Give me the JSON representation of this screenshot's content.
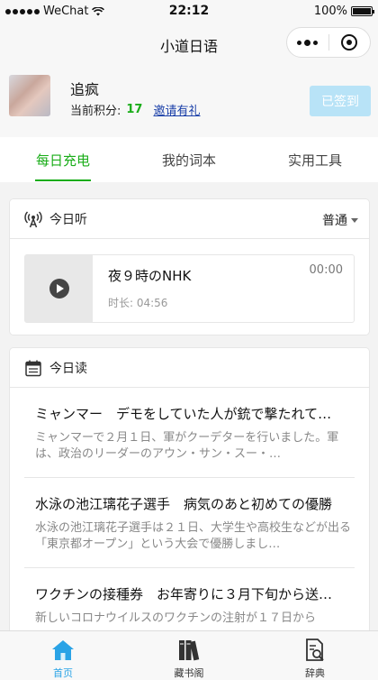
{
  "status_bar": {
    "carrier": "WeChat",
    "time": "22:12",
    "battery": "100%"
  },
  "nav": {
    "title": "小道日语"
  },
  "profile": {
    "username": "追疯",
    "points_label": "当前积分:",
    "points_value": "17",
    "invite_label": "邀请有礼",
    "signin_label": "已签到"
  },
  "tabs": [
    {
      "label": "每日充电",
      "active": true
    },
    {
      "label": "我的词本",
      "active": false
    },
    {
      "label": "实用工具",
      "active": false
    }
  ],
  "listen": {
    "title": "今日听",
    "level": "普通",
    "item": {
      "title": "夜９時のNHK",
      "duration": "时长: 04:56",
      "current_time": "00:00"
    }
  },
  "read": {
    "title": "今日读",
    "articles": [
      {
        "title": "ミャンマー　デモをしていた人が銃で撃たれて…",
        "body": "ミャンマーで２月１日、軍がクーデターを行いました。軍は、政治のリーダーのアウン・サン・スー・…"
      },
      {
        "title": "水泳の池江璃花子選手　病気のあと初めての優勝",
        "body": "水泳の池江璃花子選手は２１日、大学生や高校生などが出る「東京都オープン」という大会で優勝しまし…"
      },
      {
        "title": "ワクチンの接種券　お年寄りに３月下旬から送…",
        "body": "新しいコロナウイルスのワクチンの注射が１７日から"
      }
    ]
  },
  "tabbar": [
    {
      "label": "首页",
      "icon": "home-icon",
      "active": true
    },
    {
      "label": "藏书阁",
      "icon": "books-icon",
      "active": false
    },
    {
      "label": "辞典",
      "icon": "dictionary-search-icon",
      "active": false
    }
  ],
  "colors": {
    "accent_green": "#1aad19",
    "link_blue": "#1a3fa8",
    "tab_active_blue": "#2aa3e6",
    "signin_bg": "#b8e3f7"
  }
}
